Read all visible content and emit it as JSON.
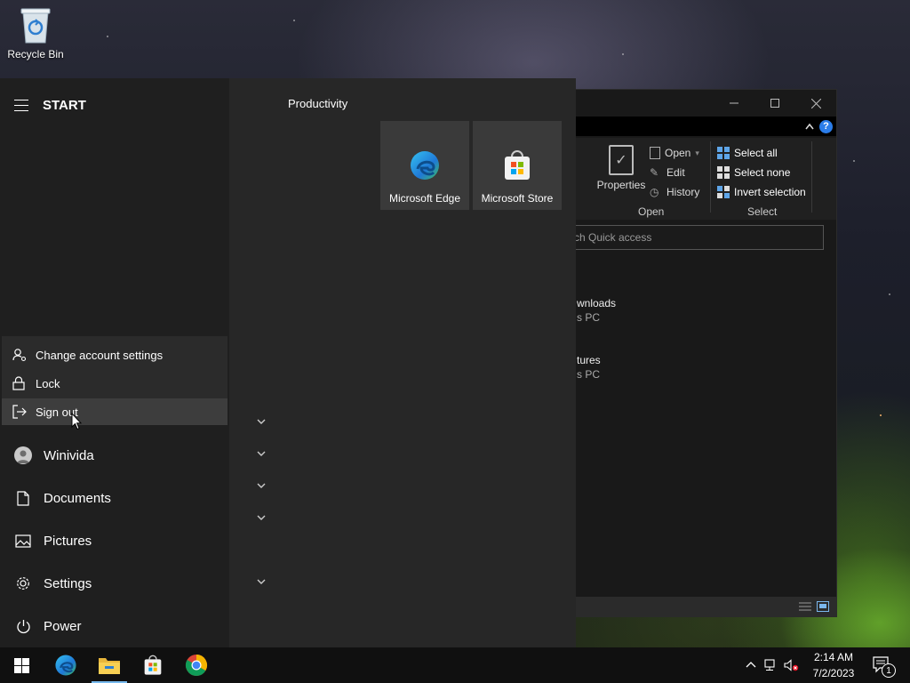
{
  "desktop": {
    "recycle_bin_label": "Recycle Bin"
  },
  "start_menu": {
    "header_title": "START",
    "account_menu": [
      {
        "label": "Change account settings",
        "icon": "person-gear-icon"
      },
      {
        "label": "Lock",
        "icon": "lock-icon"
      },
      {
        "label": "Sign out",
        "icon": "sign-out-icon"
      }
    ],
    "user_name": "Winivida",
    "nav_items": [
      {
        "label": "Documents",
        "icon": "document-icon"
      },
      {
        "label": "Pictures",
        "icon": "picture-icon"
      },
      {
        "label": "Settings",
        "icon": "gear-icon"
      },
      {
        "label": "Power",
        "icon": "power-icon"
      }
    ],
    "tile_group": "Productivity",
    "tiles": [
      {
        "label": "Microsoft Edge",
        "icon": "edge-icon"
      },
      {
        "label": "Microsoft Store",
        "icon": "store-icon"
      }
    ]
  },
  "explorer": {
    "ribbon": {
      "properties": "Properties",
      "open": "Open",
      "edit": "Edit",
      "history": "History",
      "open_group": "Open",
      "select_all": "Select all",
      "select_none": "Select none",
      "invert_selection": "Invert selection",
      "select_group": "Select"
    },
    "search_placeholder": "rch Quick access",
    "items": [
      {
        "name": "wnloads",
        "location": "s PC"
      },
      {
        "name": "tures",
        "location": "s PC"
      }
    ]
  },
  "taskbar": {
    "time": "2:14 AM",
    "date": "7/2/2023",
    "notification_count": "1"
  },
  "colors": {
    "accent": "#76b9ed",
    "help": "#2b7de9"
  }
}
